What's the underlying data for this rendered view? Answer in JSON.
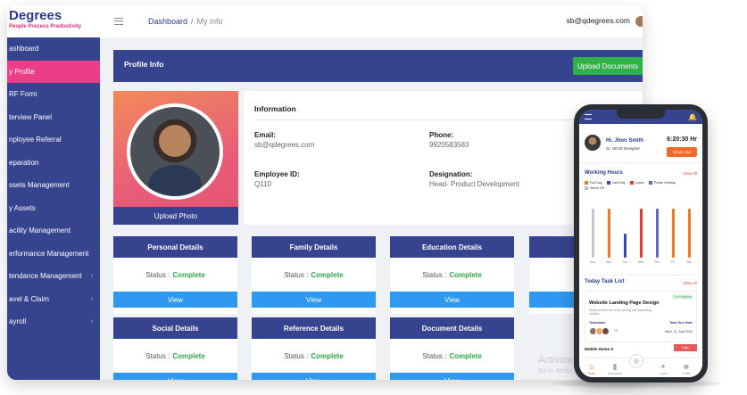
{
  "brand": {
    "name": "Degrees",
    "tagline": "People Process Productivity"
  },
  "topbar": {
    "breadcrumb_root": "Dashboard",
    "breadcrumb_sep": "/",
    "breadcrumb_current": "My info",
    "user_email": "sb@qdegrees.com"
  },
  "sidebar": {
    "items": [
      {
        "label": "ashboard"
      },
      {
        "label": "y Profile",
        "active": true
      },
      {
        "label": "RF Form"
      },
      {
        "label": "terview Panel"
      },
      {
        "label": "nployee Referral"
      },
      {
        "label": "eparation"
      },
      {
        "label": "ssets Management"
      },
      {
        "label": "y Assets"
      },
      {
        "label": "acility Management"
      },
      {
        "label": "erformance Management"
      },
      {
        "label": "tendance Management",
        "chevron": "‹"
      },
      {
        "label": "avel & Claim",
        "chevron": "‹"
      },
      {
        "label": "ayroll",
        "chevron": "‹"
      }
    ]
  },
  "profile": {
    "header_title": "Profile Info",
    "upload_documents": "Upload Documents",
    "upload_photo": "Upload Photo",
    "info_title": "Information",
    "email_label": "Email:",
    "email_value": "sb@qdegrees.com",
    "phone_label": "Phone:",
    "phone_value": "9920583583",
    "empid_label": "Employee ID:",
    "empid_value": "Q110",
    "designation_label": "Designation:",
    "designation_value": "Head- Product Development"
  },
  "details": {
    "status_label": "Status :",
    "view_label": "View",
    "cards": [
      {
        "title": "Personal Details",
        "status": "Complete"
      },
      {
        "title": "Family Details",
        "status": "Complete"
      },
      {
        "title": "Education Details",
        "status": "Complete"
      },
      {
        "title": "",
        "status": ""
      },
      {
        "title": "Social Details",
        "status": "Complete"
      },
      {
        "title": "Reference Details",
        "status": "Complete"
      },
      {
        "title": "Document Details",
        "status": "Complete"
      }
    ]
  },
  "watermark": {
    "line1": "Activate Wi",
    "line2": "Go to Settin"
  },
  "phone": {
    "greeting": "Hi, Jhon Smith",
    "role": "Sr. UI/UX Designer",
    "time": "6:20:30 Hr",
    "clock_out": "Clock Out",
    "working_hours": "Working Hours",
    "view_all": "View All",
    "legend": [
      {
        "label": "Full Day",
        "color": "#f07a2a"
      },
      {
        "label": "Half Day",
        "color": "#3949ab"
      },
      {
        "label": "Leave",
        "color": "#e53935"
      },
      {
        "label": "Public Holiday",
        "color": "#5c6bc0"
      },
      {
        "label": "Week Off",
        "color": "#bdbdbd"
      }
    ],
    "bars": [
      {
        "day": "Sun",
        "value": 0.92,
        "color": "#c7c7c7"
      },
      {
        "day": "Mon",
        "value": 0.92,
        "color": "#f07a2a"
      },
      {
        "day": "Tue",
        "value": 0.45,
        "color": "#3949ab"
      },
      {
        "day": "Wed",
        "value": 0.92,
        "color": "#e53935"
      },
      {
        "day": "Thu",
        "value": 0.92,
        "color": "#5c6bc0"
      },
      {
        "day": "Fri",
        "value": 0.92,
        "color": "#f07a2a"
      },
      {
        "day": "Sat",
        "value": 0.92,
        "color": "#f07a2a"
      }
    ],
    "today_task": "Today Task List",
    "task_badge": "On Progress",
    "task_title": "Website Landing Page Design",
    "task_desc": "Simply dummy text of the printing and typesetting industry.",
    "teammate": "Teammate",
    "task_due": "Task Due Date",
    "team_more": "+3",
    "due_date": "Wed, 11 July 2022",
    "task2_title": "Mobile Home S",
    "task2_badge": "High",
    "nav": [
      {
        "label": "Home",
        "icon": "⌂",
        "active": true
      },
      {
        "label": "Attendance",
        "icon": "▮"
      },
      {
        "label": "Leave",
        "icon": "✦"
      },
      {
        "label": "Profile",
        "icon": "☻"
      }
    ]
  }
}
